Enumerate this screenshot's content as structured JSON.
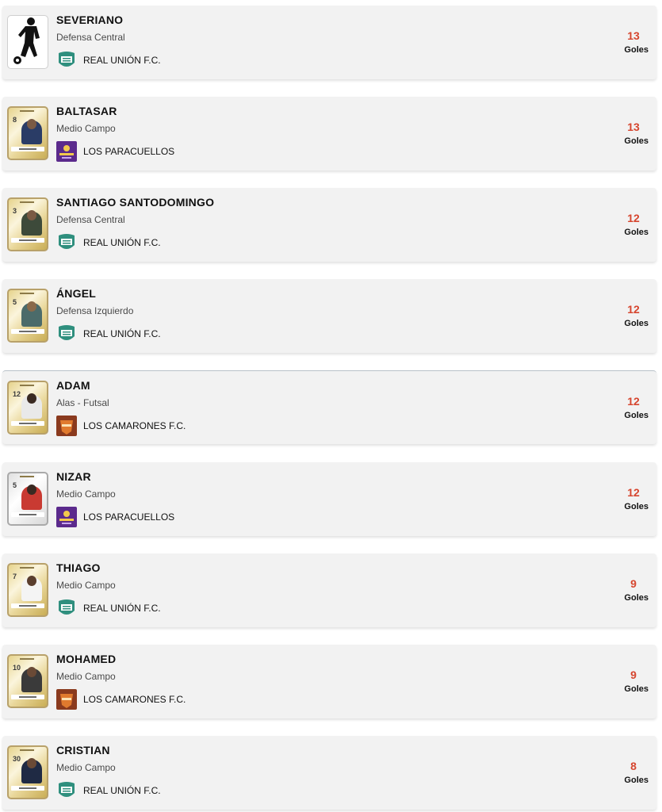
{
  "scorers": [
    {
      "name": "SEVERIANO",
      "position": "Defensa Central",
      "team": "REAL UNIÓN F.C.",
      "crest": "real-union-crest-icon",
      "goals": "13",
      "goals_label": "Goles",
      "card": "silhouette",
      "number": ""
    },
    {
      "name": "BALTASAR",
      "position": "Medio Campo",
      "team": "LOS PARACUELLOS",
      "crest": "paracuellos-crest-icon",
      "goals": "13",
      "goals_label": "Goles",
      "card": "fut",
      "number": "8"
    },
    {
      "name": "SANTIAGO SANTODOMINGO",
      "position": "Defensa Central",
      "team": "REAL UNIÓN F.C.",
      "crest": "real-union-crest-icon",
      "goals": "12",
      "goals_label": "Goles",
      "card": "fut",
      "number": "3"
    },
    {
      "name": "ÁNGEL",
      "position": "Defensa Izquierdo",
      "team": "REAL UNIÓN F.C.",
      "crest": "real-union-crest-icon",
      "goals": "12",
      "goals_label": "Goles",
      "card": "fut",
      "number": "5"
    },
    {
      "name": "ADAM",
      "position": "Alas - Futsal",
      "team": "LOS CAMARONES F.C.",
      "crest": "camarones-crest-icon",
      "goals": "12",
      "goals_label": "Goles",
      "card": "fut",
      "number": "12"
    },
    {
      "name": "NIZAR",
      "position": "Medio Campo",
      "team": "LOS PARACUELLOS",
      "crest": "paracuellos-crest-icon",
      "goals": "12",
      "goals_label": "Goles",
      "card": "fut",
      "number": "5"
    },
    {
      "name": "THIAGO",
      "position": "Medio Campo",
      "team": "REAL UNIÓN F.C.",
      "crest": "real-union-crest-icon",
      "goals": "9",
      "goals_label": "Goles",
      "card": "fut",
      "number": "7"
    },
    {
      "name": "MOHAMED",
      "position": "Medio Campo",
      "team": "LOS CAMARONES F.C.",
      "crest": "camarones-crest-icon",
      "goals": "9",
      "goals_label": "Goles",
      "card": "fut",
      "number": "10"
    },
    {
      "name": "CRISTIAN",
      "position": "Medio Campo",
      "team": "REAL UNIÓN F.C.",
      "crest": "real-union-crest-icon",
      "goals": "8",
      "goals_label": "Goles",
      "card": "fut",
      "number": "30"
    }
  ],
  "colors": {
    "goals_accent": "#d6452e",
    "row_background": "#f2f2f2",
    "real_union": "#2f8f7e",
    "paracuellos": "#5b2a8c",
    "camarones": "#8a3a1e"
  }
}
